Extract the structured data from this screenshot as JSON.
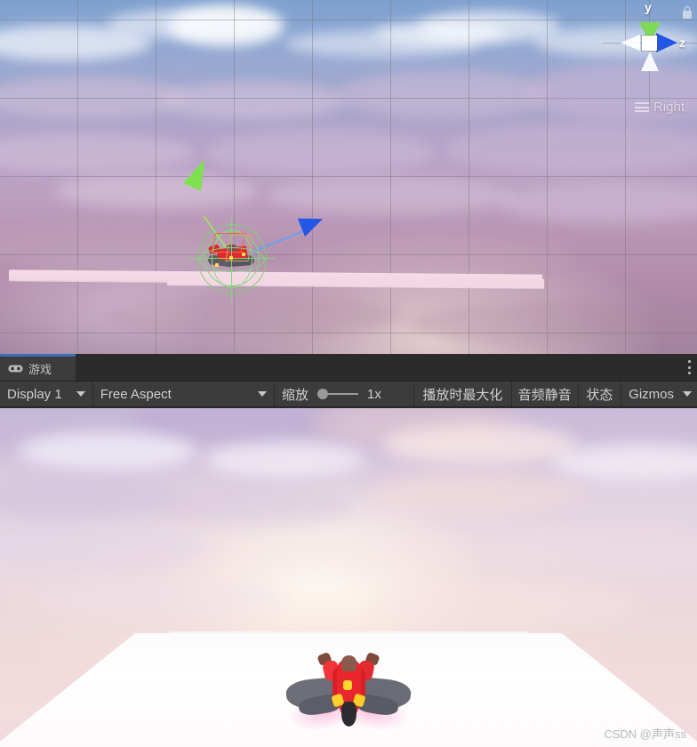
{
  "window": {
    "app": "Unity Editor",
    "kebab_icon": "more-options-icon"
  },
  "scene_view": {
    "name": "Scene View",
    "grid_visible": true,
    "orientation_gizmo": {
      "y_label": "y",
      "z_label": "z",
      "view_caption": "Right",
      "lock_icon": "lock-icon",
      "menu_icon": "hamburger-icon",
      "axis_colors": {
        "y": "#7ed957",
        "z": "#2456e8",
        "x_neg": "#ffffff",
        "center": "#ffffff"
      }
    },
    "selection": {
      "tool": "rotate",
      "gizmo_color": "#7fd873",
      "y_handle_color": "#7ed957",
      "z_handle_color": "#2456e8",
      "object": "red-aircraft"
    },
    "colors": {
      "sky_top": "#7fa0cf",
      "sky_bottom": "#a2839f",
      "platform": "#f4d7e4",
      "grid_line": "#787378"
    }
  },
  "tabbar": {
    "tabs": [
      {
        "label": "游戏",
        "icon": "gamepad-icon",
        "active": true
      }
    ],
    "accent_color": "#3c6eb4",
    "options_label": "⋮"
  },
  "toolbar": {
    "display": {
      "label": "Display 1",
      "caret_icon": "chevron-down-icon"
    },
    "aspect": {
      "label": "Free Aspect",
      "caret_icon": "chevron-down-icon"
    },
    "zoom": {
      "label": "缩放",
      "value": "1x",
      "slider_position": 0
    },
    "maximize_on_play": {
      "label": "播放时最大化",
      "active": false
    },
    "mute_audio": {
      "label": "音频静音",
      "active": false
    },
    "stats": {
      "label": "状态",
      "active": false
    },
    "gizmos": {
      "label": "Gizmos",
      "caret_icon": "chevron-down-icon",
      "active": false
    },
    "colors": {
      "background": "#3c3c3c",
      "text": "#cfcfcf",
      "border": "#232323"
    }
  },
  "game_view": {
    "name": "Game View",
    "content": "red-aircraft-over-white-platform",
    "colors": {
      "sky_top": "#c8bbd8",
      "sky_bottom": "#f1dade",
      "sun_glow": "#fffcf4",
      "platform": "#ffffff",
      "plane_body": "#e8262c",
      "plane_wing": "#6e6e78",
      "plane_accent": "#ffd92e",
      "trail": "#ffa0cd"
    }
  },
  "watermark": {
    "text": "CSDN @声声ss"
  }
}
